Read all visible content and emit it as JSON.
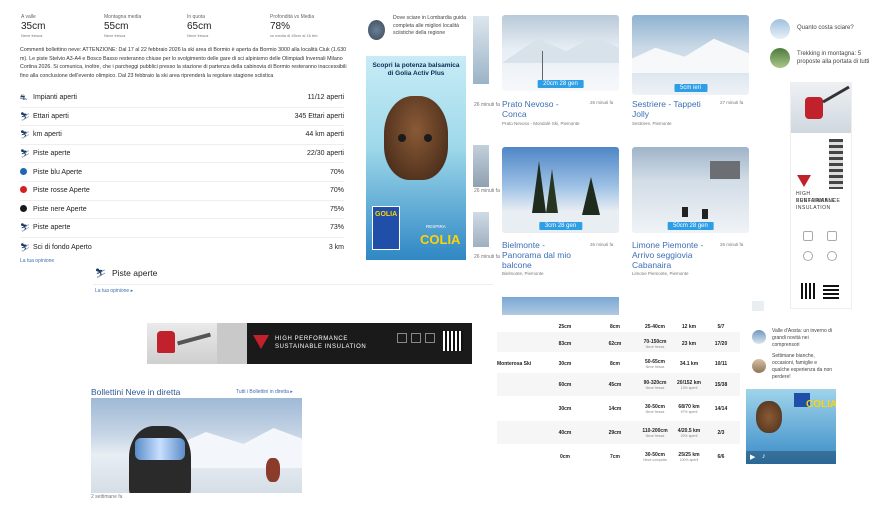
{
  "stats": [
    {
      "label": "A valle",
      "value": "35cm",
      "sub": "Neve fresca"
    },
    {
      "label": "Montagna media",
      "value": "55cm",
      "sub": "Neve fresca"
    },
    {
      "label": "In quota",
      "value": "65cm",
      "sub": "Neve fresca"
    },
    {
      "label": "Profondità vs Media",
      "value": "78%",
      "sub": "vs media di 45cm al 16 feb"
    }
  ],
  "bulletin": "Commenti bollettino neve: ATTENZIONE: Dal 17 al 22 febbraio 2026 la ski area di Bormio è aperta da Bormio 3000 alla località Ciuk (1.630 m). Le piste Stelvio A3-A4 e Bosco Basso resteranno chiuse per lo svolgimento delle gare di sci alpinismo delle Olimpiadi Invernali Milano Cortina 2026. Si comunica, inoltre, che i parcheggi pubblici presso la stazione di partenza della cabinovia di Bormio resteranno inaccessibili fino alla conclusione dell'evento olimpico. Dal 23 febbraio la ski area riprenderà la regolare stagione sciistica",
  "rows": [
    {
      "label": "Impianti aperti",
      "value": "11/12 aperti"
    },
    {
      "label": "Ettari aperti",
      "value": "345 Ettari aperti"
    },
    {
      "label": "km aperti",
      "value": "44 km aperti"
    },
    {
      "label": "Piste aperte",
      "value": "22/30 aperti"
    },
    {
      "label": "Piste blu Aperte",
      "value": "70%"
    },
    {
      "label": "Piste rosse Aperte",
      "value": "70%"
    },
    {
      "label": "Piste nere Aperte",
      "value": "75%"
    },
    {
      "label": "Piste aperte",
      "value": "73%"
    },
    {
      "label": "Sci di fondo Aperto",
      "value": "3 km"
    }
  ],
  "opinion_link_small": "La tua opinione",
  "piste_heading": "Piste aperte",
  "opinion_link": "La tua opinione ▸",
  "banner": {
    "brand": "HIGH PERFORMANCE",
    "tag": "SUSTAINABLE INSULATION"
  },
  "live": {
    "title": "Bollettini Neve in diretta",
    "link": "Tutti i Bollettini in diretta ▸",
    "caption": "2 settimane fa"
  },
  "article": {
    "text": "Dove sciare in Lombardia guida completa alle migliori località sciistiche della regione"
  },
  "colia_ad": {
    "headline": "Scopri la potenza balsamica di Golia Activ Plus",
    "brand": "GOLIA",
    "cta": "RESPIRA",
    "slogan": "COLIA"
  },
  "cams": [
    {
      "badge": "20cm 28 gen",
      "title": "Prato Nevoso - Conca",
      "sub": "Prato Nevoso - Mondolè Ski, Piemonte",
      "time": "26 minuti fa"
    },
    {
      "badge": "5cm ieri",
      "title": "Sestriere - Tappeti Jolly",
      "sub": "Sestriere, Piemonte",
      "time": "27 minuti fa"
    },
    {
      "badge": "3cm 28 gen",
      "title": "Bielmonte - Panorama dal mio balcone",
      "sub": "Bielmonte, Piemonte",
      "time": "26 minuti fa"
    },
    {
      "badge": "50cm 28 gen",
      "title": "Limone Piemonte - Arrivo seggiovia Cabanaira",
      "sub": "Limone Piemonte, Piemonte",
      "time": "26 minuti fa"
    }
  ],
  "side_times": [
    "26 minuti fa",
    "26 minuti fa",
    "26 minuti fa"
  ],
  "table": [
    {
      "name": "",
      "a": "25cm",
      "b": "8cm",
      "c": "25-40cm",
      "cs": "",
      "d": "12 km",
      "ds": "",
      "e": "5/7"
    },
    {
      "name": "",
      "a": "83cm",
      "b": "62cm",
      "c": "70-150cm",
      "cs": "Neve fresca",
      "d": "23 km",
      "ds": "",
      "e": "17/20"
    },
    {
      "name": "Monterosa Ski",
      "a": "30cm",
      "b": "8cm",
      "c": "50-65cm",
      "cs": "Neve fresca",
      "d": "34.1 km",
      "ds": "",
      "e": "10/11"
    },
    {
      "name": "",
      "a": "60cm",
      "b": "45cm",
      "c": "90-320cm",
      "cs": "Neve fresca",
      "d": "20/152 km",
      "ds": "13% aperti",
      "e": "15/38"
    },
    {
      "name": "",
      "a": "30cm",
      "b": "14cm",
      "c": "30-50cm",
      "cs": "Neve fresca",
      "d": "68/70 km",
      "ds": "97% aperti",
      "e": "14/14"
    },
    {
      "name": "",
      "a": "40cm",
      "b": "29cm",
      "c": "110-200cm",
      "cs": "Neve fresca",
      "d": "4/20.5 km",
      "ds": "20% aperti",
      "e": "2/3"
    },
    {
      "name": "",
      "a": "0cm",
      "b": "7cm",
      "c": "30-50cm",
      "cs": "Neve compatta",
      "d": "25/25 km",
      "ds": "100% aperti",
      "e": "6/6"
    }
  ],
  "right_articles": [
    {
      "text": "Quanto costa sciare?"
    },
    {
      "text": "Trekking in montagna: 5 proposte alla portata di tutti"
    }
  ],
  "right_lower": [
    {
      "text": "Valle d'Aosta: un inverno di grandi novità nei comprensori"
    },
    {
      "text": "Settimane bianche, occasioni, famiglie e qualche esperienza da non perdere!"
    }
  ],
  "right_ad": {
    "brand": "HIGH PERFORMANCE",
    "tag": "SUSTAINABLE INSULATION"
  },
  "colors": {
    "accent": "#2e9ee6",
    "link": "#3b6fb3",
    "blue": "#1f66b4",
    "red": "#d42020",
    "black": "#1a1a1a"
  },
  "icons": [
    "lift-icon",
    "area-icon",
    "distance-icon",
    "skier-icon",
    "blue-slope-icon",
    "red-slope-icon",
    "black-slope-icon",
    "skier-icon",
    "cross-country-icon"
  ]
}
